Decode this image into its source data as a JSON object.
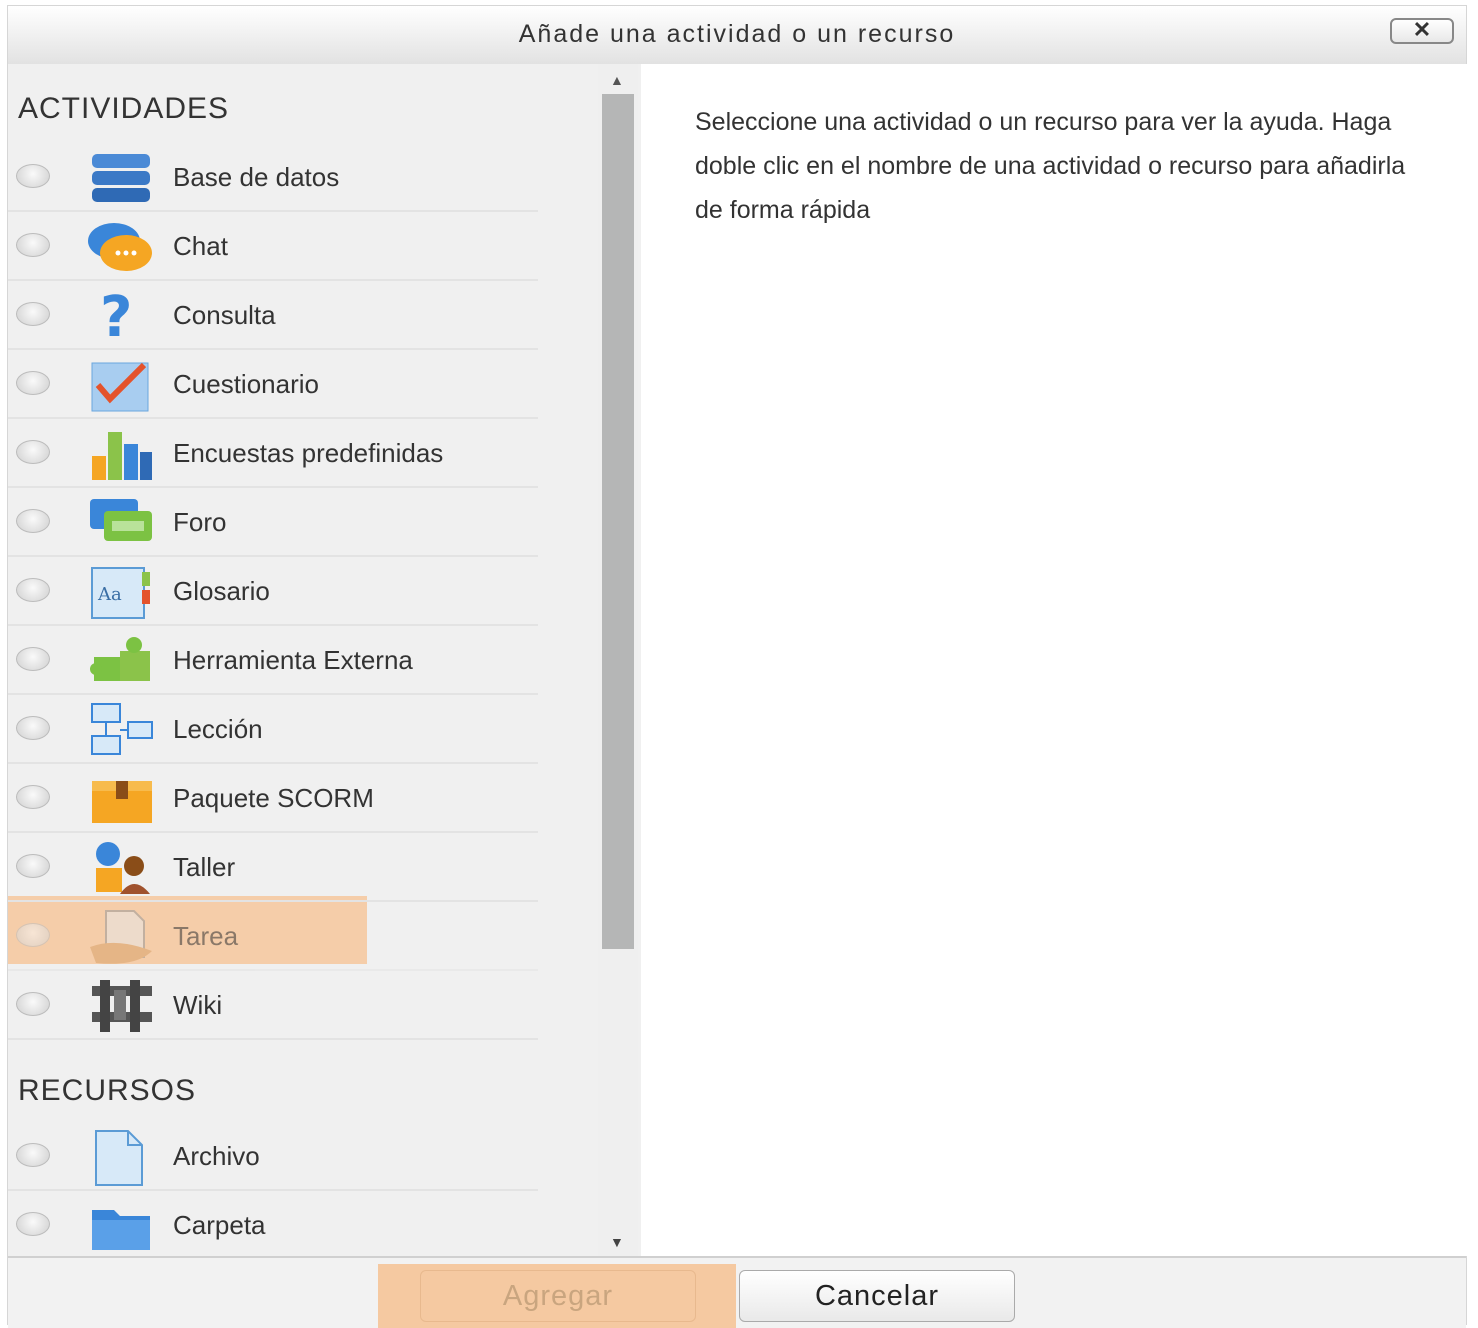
{
  "dialog": {
    "title": "Añade una actividad o un recurso",
    "close_label": "✕"
  },
  "sections": {
    "activities_title": "ACTIVIDADES",
    "resources_title": "RECURSOS"
  },
  "activities": [
    {
      "label": "Base de datos",
      "icon": "database-icon"
    },
    {
      "label": "Chat",
      "icon": "chat-icon"
    },
    {
      "label": "Consulta",
      "icon": "question-icon"
    },
    {
      "label": "Cuestionario",
      "icon": "quiz-icon"
    },
    {
      "label": "Encuestas predefinidas",
      "icon": "survey-chart-icon"
    },
    {
      "label": "Foro",
      "icon": "forum-icon"
    },
    {
      "label": "Glosario",
      "icon": "glossary-icon"
    },
    {
      "label": "Herramienta Externa",
      "icon": "puzzle-icon"
    },
    {
      "label": "Lección",
      "icon": "lesson-icon"
    },
    {
      "label": "Paquete SCORM",
      "icon": "package-icon"
    },
    {
      "label": "Taller",
      "icon": "workshop-icon"
    },
    {
      "label": "Tarea",
      "icon": "assignment-icon",
      "highlighted": true
    },
    {
      "label": "Wiki",
      "icon": "wiki-icon"
    }
  ],
  "resources": [
    {
      "label": "Archivo",
      "icon": "file-icon"
    },
    {
      "label": "Carpeta",
      "icon": "folder-icon"
    }
  ],
  "help_text": "Seleccione una actividad o un recurso para ver la ayuda. Haga doble clic en el nombre de una actividad o recurso para añadirla de forma rápida",
  "footer": {
    "add_label": "Agregar",
    "cancel_label": "Cancelar"
  },
  "colors": {
    "highlight": "#f5c9a1",
    "panel_bg": "#f0f0f0"
  }
}
